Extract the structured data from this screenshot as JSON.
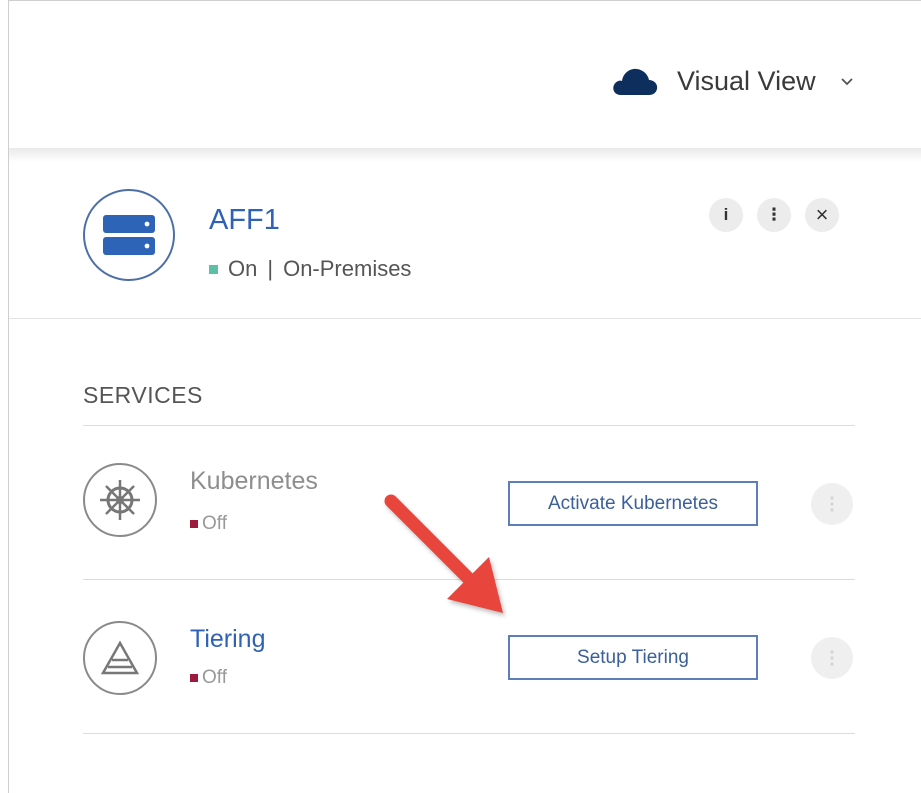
{
  "view_selector": {
    "label": "Visual View",
    "icon": "cloud-icon"
  },
  "environment": {
    "name": "AFF1",
    "state": "On",
    "separator": "|",
    "location": "On-Premises",
    "icon": "storage-server-icon",
    "state_color": "#5bc0a6",
    "actions": [
      {
        "name": "info-button",
        "glyph": "i"
      },
      {
        "name": "more-options-button",
        "glyph": "⋮"
      },
      {
        "name": "close-button",
        "glyph": "×"
      }
    ]
  },
  "services": {
    "title": "SERVICES",
    "items": [
      {
        "name": "Kubernetes",
        "status": "Off",
        "button_label": "Activate Kubernetes",
        "icon": "kubernetes-helm-icon",
        "name_color": "#8e8e8e"
      },
      {
        "name": "Tiering",
        "status": "Off",
        "button_label": "Setup Tiering",
        "icon": "tiering-triangle-icon",
        "name_color": "#2f62b6"
      }
    ],
    "off_color": "#9c1b3d"
  },
  "annotation": {
    "icon": "red-arrow-icon",
    "color": "#e8453c"
  }
}
